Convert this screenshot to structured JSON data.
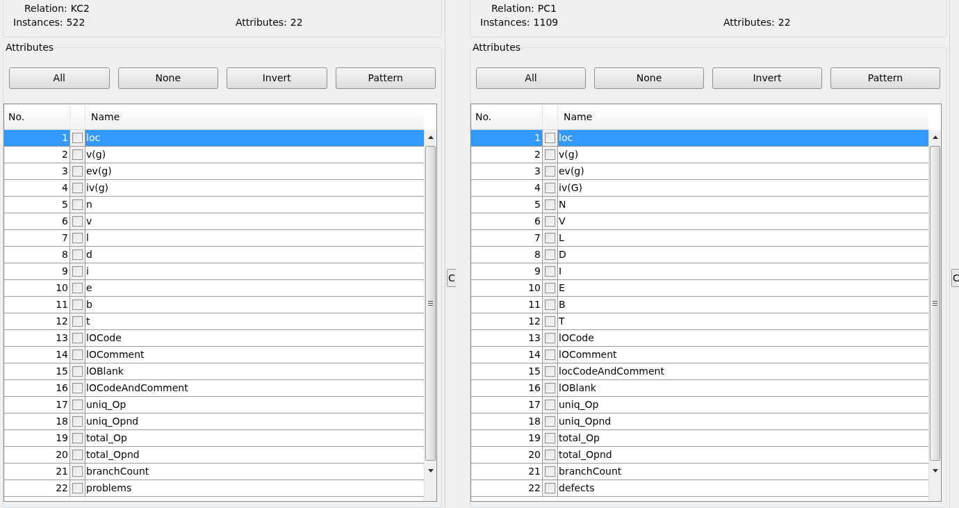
{
  "panels": [
    {
      "relation_label": "Relation:",
      "relation": "KC2",
      "instances_label": "Instances:",
      "instances": "522",
      "attributes_label": "Attributes:",
      "attributes_count": "22",
      "group_title": "Attributes",
      "buttons": [
        "All",
        "None",
        "Invert",
        "Pattern"
      ],
      "columns": [
        "No.",
        "Name"
      ],
      "side_button": "C",
      "rows": [
        {
          "no": "1",
          "name": "loc",
          "checked": false,
          "selected": true
        },
        {
          "no": "2",
          "name": "v(g)",
          "checked": false,
          "selected": false
        },
        {
          "no": "3",
          "name": "ev(g)",
          "checked": false,
          "selected": false
        },
        {
          "no": "4",
          "name": "iv(g)",
          "checked": false,
          "selected": false
        },
        {
          "no": "5",
          "name": "n",
          "checked": false,
          "selected": false
        },
        {
          "no": "6",
          "name": "v",
          "checked": false,
          "selected": false
        },
        {
          "no": "7",
          "name": "l",
          "checked": false,
          "selected": false
        },
        {
          "no": "8",
          "name": "d",
          "checked": false,
          "selected": false
        },
        {
          "no": "9",
          "name": "i",
          "checked": false,
          "selected": false
        },
        {
          "no": "10",
          "name": "e",
          "checked": false,
          "selected": false
        },
        {
          "no": "11",
          "name": "b",
          "checked": false,
          "selected": false
        },
        {
          "no": "12",
          "name": "t",
          "checked": false,
          "selected": false
        },
        {
          "no": "13",
          "name": "lOCode",
          "checked": false,
          "selected": false
        },
        {
          "no": "14",
          "name": "lOComment",
          "checked": false,
          "selected": false
        },
        {
          "no": "15",
          "name": "lOBlank",
          "checked": false,
          "selected": false
        },
        {
          "no": "16",
          "name": "lOCodeAndComment",
          "checked": false,
          "selected": false
        },
        {
          "no": "17",
          "name": "uniq_Op",
          "checked": false,
          "selected": false
        },
        {
          "no": "18",
          "name": "uniq_Opnd",
          "checked": false,
          "selected": false
        },
        {
          "no": "19",
          "name": "total_Op",
          "checked": false,
          "selected": false
        },
        {
          "no": "20",
          "name": "total_Opnd",
          "checked": false,
          "selected": false
        },
        {
          "no": "21",
          "name": "branchCount",
          "checked": false,
          "selected": false
        },
        {
          "no": "22",
          "name": "problems",
          "checked": false,
          "selected": false
        }
      ]
    },
    {
      "relation_label": "Relation:",
      "relation": "PC1",
      "instances_label": "Instances:",
      "instances": "1109",
      "attributes_label": "Attributes:",
      "attributes_count": "22",
      "group_title": "Attributes",
      "buttons": [
        "All",
        "None",
        "Invert",
        "Pattern"
      ],
      "columns": [
        "No.",
        "Name"
      ],
      "side_button": "C",
      "rows": [
        {
          "no": "1",
          "name": "loc",
          "checked": false,
          "selected": true
        },
        {
          "no": "2",
          "name": "v(g)",
          "checked": false,
          "selected": false
        },
        {
          "no": "3",
          "name": "ev(g)",
          "checked": false,
          "selected": false
        },
        {
          "no": "4",
          "name": "iv(G)",
          "checked": false,
          "selected": false
        },
        {
          "no": "5",
          "name": "N",
          "checked": false,
          "selected": false
        },
        {
          "no": "6",
          "name": "V",
          "checked": false,
          "selected": false
        },
        {
          "no": "7",
          "name": "L",
          "checked": false,
          "selected": false
        },
        {
          "no": "8",
          "name": "D",
          "checked": false,
          "selected": false
        },
        {
          "no": "9",
          "name": "I",
          "checked": false,
          "selected": false
        },
        {
          "no": "10",
          "name": "E",
          "checked": false,
          "selected": false
        },
        {
          "no": "11",
          "name": "B",
          "checked": false,
          "selected": false
        },
        {
          "no": "12",
          "name": "T",
          "checked": false,
          "selected": false
        },
        {
          "no": "13",
          "name": "lOCode",
          "checked": false,
          "selected": false
        },
        {
          "no": "14",
          "name": "lOComment",
          "checked": false,
          "selected": false
        },
        {
          "no": "15",
          "name": "locCodeAndComment",
          "checked": false,
          "selected": false
        },
        {
          "no": "16",
          "name": "lOBlank",
          "checked": false,
          "selected": false
        },
        {
          "no": "17",
          "name": "uniq_Op",
          "checked": false,
          "selected": false
        },
        {
          "no": "18",
          "name": "uniq_Opnd",
          "checked": false,
          "selected": false
        },
        {
          "no": "19",
          "name": "total_Op",
          "checked": false,
          "selected": false
        },
        {
          "no": "20",
          "name": "total_Opnd",
          "checked": false,
          "selected": false
        },
        {
          "no": "21",
          "name": "branchCount",
          "checked": false,
          "selected": false
        },
        {
          "no": "22",
          "name": "defects",
          "checked": false,
          "selected": false
        }
      ]
    }
  ]
}
